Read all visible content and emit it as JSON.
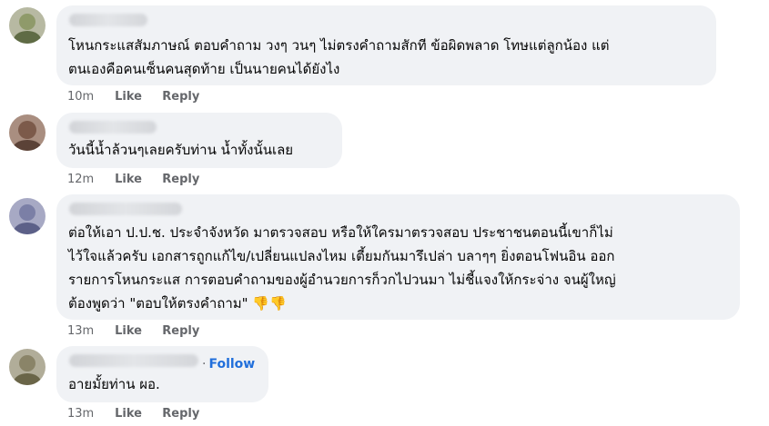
{
  "comments": [
    {
      "lines": [
        "โหนกระแสสัมภาษณ์ ตอบคำถาม วงๆ วนๆ ไม่ตรงคำถามสักที ข้อผิดพลาด โทษแต่ลูกน้อง แต่",
        "ตนเองคือคนเซ็นคนสุดท้าย เป็นนายคนได้ยังไง"
      ],
      "time": "10m",
      "like": "Like",
      "reply": "Reply"
    },
    {
      "lines": [
        "วันนี้น้ำล้วนๆเลยครับท่าน น้ำทั้งนั้นเลย"
      ],
      "time": "12m",
      "like": "Like",
      "reply": "Reply"
    },
    {
      "lines": [
        "ต่อให้เอา ป.ป.ช. ประจำจังหวัด มาตรวจสอบ หรือให้ใครมาตรวจสอบ ประชาชนตอนนี้เขาก็ไม่",
        "ไว้ใจแล้วครับ เอกสารถูกแก้ไข/เปลี่ยนแปลงไหม เตี้ยมกันมารึเปล่า บลาๆๆ ยิ่งตอนโฟนอิน ออก",
        "รายการโหนกระแส การตอบคำถามของผู้อำนวยการก็วกไปวนมา ไม่ชี้แจงให้กระจ่าง จนผู้ใหญ่",
        "ต้องพูดว่า \"ตอบให้ตรงคำถาม\""
      ],
      "emoji": "👎👎",
      "time": "13m",
      "like": "Like",
      "reply": "Reply"
    },
    {
      "follow_dot": "·",
      "follow": "Follow",
      "lines": [
        "อายมั้ยท่าน ผอ."
      ],
      "time": "13m",
      "like": "Like",
      "reply": "Reply"
    }
  ],
  "colors": {
    "bubble": "#f0f2f5",
    "meta": "#65676b",
    "follow": "#216fdb",
    "emoji": "#f7b928"
  }
}
